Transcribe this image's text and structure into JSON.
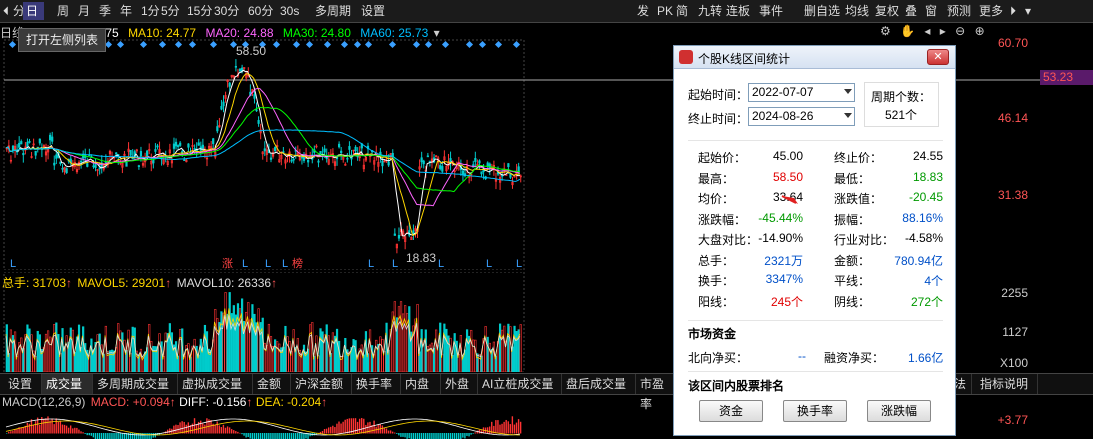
{
  "toolbar": {
    "left_items": [
      "分时",
      "日",
      "周",
      "月",
      "季",
      "年",
      "1分",
      "5分",
      "15分",
      "30分",
      "60分",
      "30s",
      "多周期",
      "设置"
    ],
    "active_item": "日",
    "right_items": [
      "发",
      "PK",
      "简",
      "九转",
      "连板",
      "事件",
      "删自选",
      "均线",
      "复权",
      "叠",
      "窗",
      "预测",
      "更多"
    ]
  },
  "main_chart": {
    "legend": {
      "prefix": "日线-UW",
      "ma5": "MA5: 24.75",
      "ma10": "MA10: 24.77",
      "ma20": "MA20: 24.88",
      "ma30": "MA30: 24.80",
      "ma60": "MA60: 25.73"
    },
    "axis_labels": [
      "60.70",
      "53.23",
      "46.14",
      "31.38"
    ],
    "high_marker": "58.50",
    "low_marker": "18.83",
    "bottom_marks": [
      "L",
      "涨",
      "L",
      "L",
      "L",
      "榜",
      "L",
      "L",
      "L",
      "L",
      "L"
    ],
    "colors": {
      "ma5": "#ffffff",
      "ma10": "#ffd700",
      "ma20": "#ff66ff",
      "ma30": "#00ff00",
      "ma60": "#00bfff",
      "up": "#ff3333",
      "down": "#00cccc"
    }
  },
  "tooltip": {
    "text": "打开左侧列表"
  },
  "volume_panel": {
    "legend": {
      "total": "总手: 31703",
      "mavol5": "MAVOL5: 29201",
      "mavol10": "MAVOL10: 26336"
    },
    "axis_labels": [
      "2255",
      "1127",
      "X100"
    ]
  },
  "tabs": {
    "items": [
      "设置",
      "成交量",
      "多周期成交量",
      "虚拟成交量",
      "金额",
      "沪深金额",
      "换手率",
      "内盘",
      "外盘",
      "AI立桩成交量",
      "盘后成交量",
      "市盈率"
    ],
    "active": "成交量",
    "right_items": [
      "法",
      "指标说明"
    ]
  },
  "macd_panel": {
    "legend": {
      "name": "MACD(12,26,9)",
      "macd": "MACD: +0.094",
      "diff": "DIFF: -0.156",
      "dea": "DEA: -0.204"
    },
    "axis_label": "+3.77"
  },
  "dialog": {
    "title": "个股K线区间统计",
    "start_label": "起始时间：",
    "start_value": "2022-07-07",
    "end_label": "终止时间：",
    "end_value": "2024-08-26",
    "period_count_label": "周期个数：",
    "period_count_value": "521个",
    "stats": [
      {
        "label": "起始价：",
        "value": "45.00",
        "color": "blk",
        "label2": "终止价：",
        "value2": "24.55",
        "color2": "blk"
      },
      {
        "label": "最高：",
        "value": "58.50",
        "color": "red",
        "label2": "最低：",
        "value2": "18.83",
        "color2": "green"
      },
      {
        "label": "均价：",
        "value": "33.64",
        "color": "blk",
        "label2": "涨跌值：",
        "value2": "-20.45",
        "color2": "green"
      },
      {
        "label": "涨跌幅：",
        "value": "-45.44%",
        "color": "green",
        "label2": "振幅：",
        "value2": "88.16%",
        "color2": "blue"
      },
      {
        "label": "大盘对比：",
        "value": "-14.90%",
        "color": "blk",
        "label2": "行业对比：",
        "value2": "-4.58%",
        "color2": "blk"
      },
      {
        "label": "总手：",
        "value": "2321万",
        "color": "blue",
        "label2": "金额：",
        "value2": "780.94亿",
        "color2": "blue"
      },
      {
        "label": "换手：",
        "value": "3347%",
        "color": "blue",
        "label2": "平线：",
        "value2": "4个",
        "color2": "blue"
      },
      {
        "label": "阳线：",
        "value": "245个",
        "color": "red",
        "label2": "阴线：",
        "value2": "272个",
        "color2": "green"
      }
    ],
    "market_section": "市场资金",
    "north_label": "北向净买：",
    "north_value": "--",
    "margin_label": "融资净买：",
    "margin_value": "1.66亿",
    "rank_section": "该区间内股票排名",
    "buttons": [
      "资金",
      "换手率",
      "涨跌幅"
    ]
  }
}
